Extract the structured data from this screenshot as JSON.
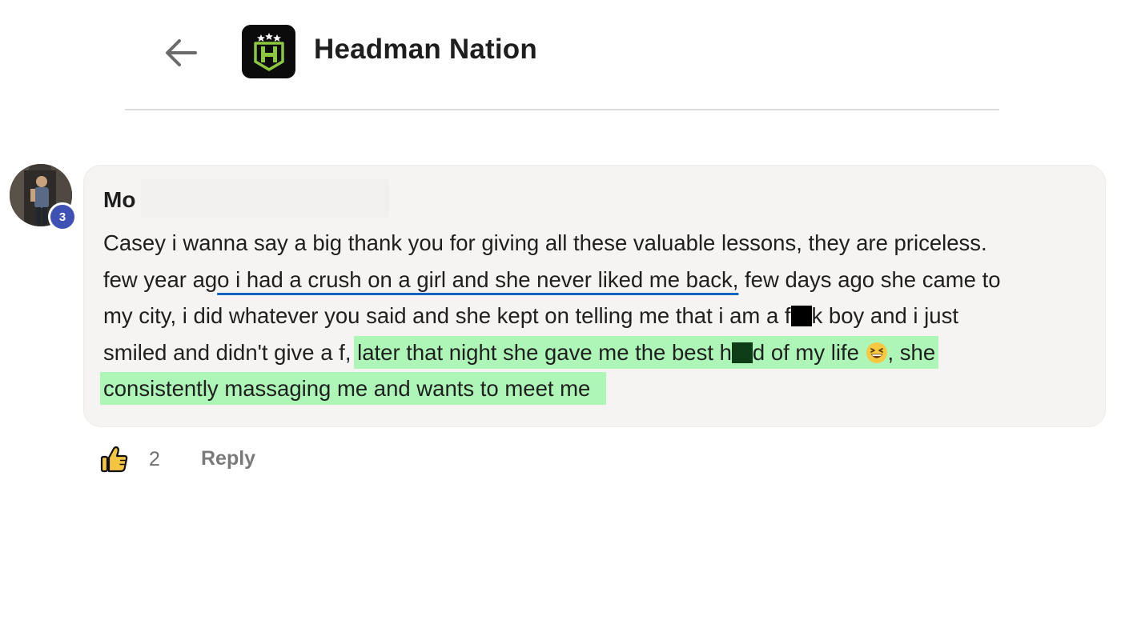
{
  "header": {
    "title": "Headman Nation",
    "back_icon": "arrow-left-icon",
    "logo_icon": "headman-h-logo"
  },
  "comment": {
    "author": "Mo",
    "avatar_badge": "3",
    "lines": {
      "l1": "Casey i wanna say a big thank you for giving all these valuable lessons, they are priceless.",
      "l2_a": "few year ag",
      "l2_b": "o i had a crush on a girl and she never liked me back,",
      "l2_c": " few days ago she came to",
      "l3_a": "my city, i did whatever you said and she kept on telling me that i am a f",
      "l3_b": "k boy and i just",
      "l4_a": "smiled and didn't give a f, ",
      "l4_b": "later that night she gave me the best h",
      "l4_c": "d of my life ",
      "l4_d": ", she",
      "l5": "consistently massaging me and wants to meet me"
    },
    "emoji": "grinning-squinting-face"
  },
  "actions": {
    "like_icon": "thumbs-up-icon",
    "like_count": "2",
    "reply_label": "Reply"
  },
  "colors": {
    "highlight": "#aef5b8",
    "underline": "#1565c0",
    "badge": "#3f51b5",
    "logo_accent": "#8dc63f"
  }
}
